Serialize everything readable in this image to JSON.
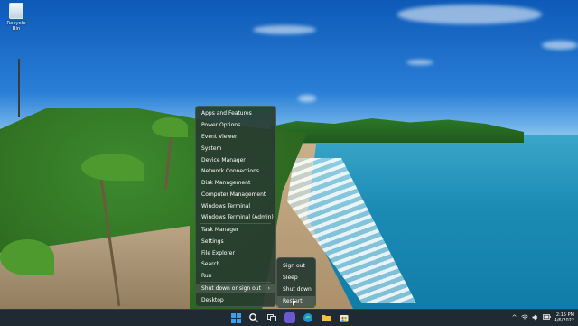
{
  "desktop": {
    "icons": [
      {
        "label": "Recycle Bin",
        "icon": "recycle-bin-icon"
      }
    ]
  },
  "winx_menu": {
    "items": [
      {
        "label": "Apps and Features"
      },
      {
        "label": "Power Options"
      },
      {
        "label": "Event Viewer"
      },
      {
        "label": "System"
      },
      {
        "label": "Device Manager"
      },
      {
        "label": "Network Connections"
      },
      {
        "label": "Disk Management"
      },
      {
        "label": "Computer Management"
      },
      {
        "label": "Windows Terminal"
      },
      {
        "label": "Windows Terminal (Admin)"
      },
      {
        "label": "Task Manager"
      },
      {
        "label": "Settings"
      },
      {
        "label": "File Explorer"
      },
      {
        "label": "Search"
      },
      {
        "label": "Run"
      },
      {
        "label": "Shut down or sign out",
        "has_submenu": true,
        "highlighted": true
      },
      {
        "label": "Desktop"
      }
    ],
    "submenu_chevron": "›"
  },
  "shutdown_submenu": {
    "items": [
      {
        "label": "Sign out"
      },
      {
        "label": "Sleep"
      },
      {
        "label": "Shut down"
      },
      {
        "label": "Restart",
        "hovered": true
      }
    ]
  },
  "taskbar": {
    "apps": [
      "start-icon",
      "search-icon",
      "task-view-icon",
      "chat-icon",
      "edge-icon",
      "file-explorer-icon",
      "store-icon"
    ],
    "tray": {
      "chevron": "^",
      "icons": [
        "wifi-icon",
        "volume-icon",
        "battery-icon"
      ],
      "time": "2:15 PM",
      "date": "4/6/2022"
    }
  },
  "colors": {
    "menu_bg": "#283c30",
    "taskbar_bg": "#1f2a33",
    "accent": "#3aa0f0"
  }
}
